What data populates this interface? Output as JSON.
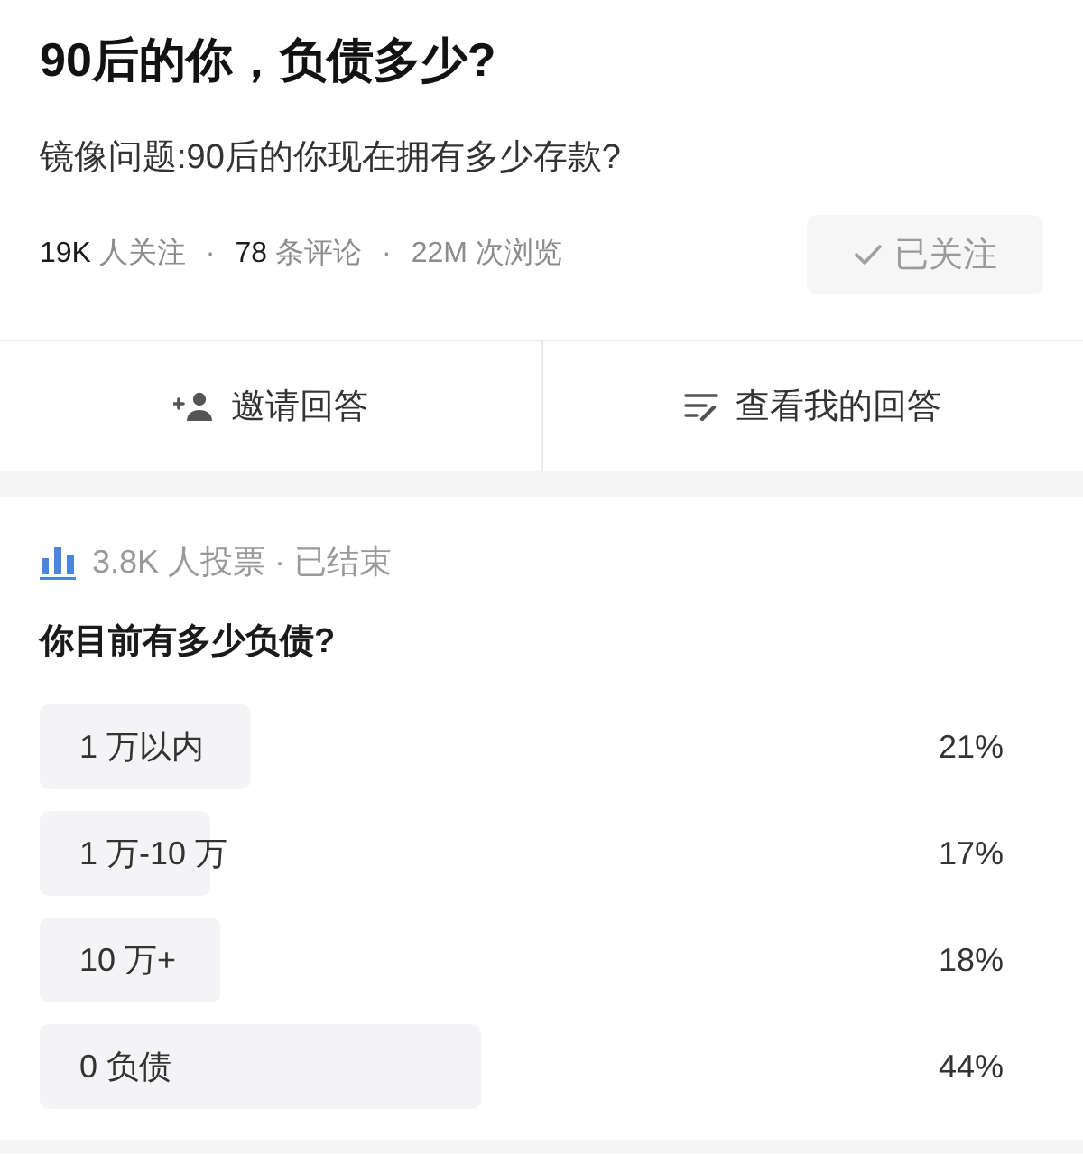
{
  "question": {
    "title": "90后的你，负债多少?",
    "subtitle": "镜像问题:90后的你现在拥有多少存款?",
    "stats": [
      {
        "count": "19K",
        "unit": "人关注",
        "emphasized": true
      },
      {
        "count": "78",
        "unit": "条评论",
        "emphasized": true
      },
      {
        "count": "22M",
        "unit": "次浏览",
        "emphasized": false
      }
    ],
    "stat_separator": "·",
    "follow_button": {
      "label": "已关注",
      "following": true
    }
  },
  "actions": [
    {
      "kind": "invite",
      "label": "邀请回答"
    },
    {
      "kind": "my_answer",
      "label": "查看我的回答"
    }
  ],
  "poll": {
    "summary": "3.8K 人投票 · 已结束",
    "question": "你目前有多少负债?",
    "chart_data": {
      "type": "bar",
      "orientation": "horizontal",
      "categories": [
        "1 万以内",
        "1 万-10 万",
        "10 万+",
        "0 负债"
      ],
      "values": [
        21,
        17,
        18,
        44
      ],
      "value_labels": [
        "21%",
        "17%",
        "18%",
        "44%"
      ]
    }
  }
}
